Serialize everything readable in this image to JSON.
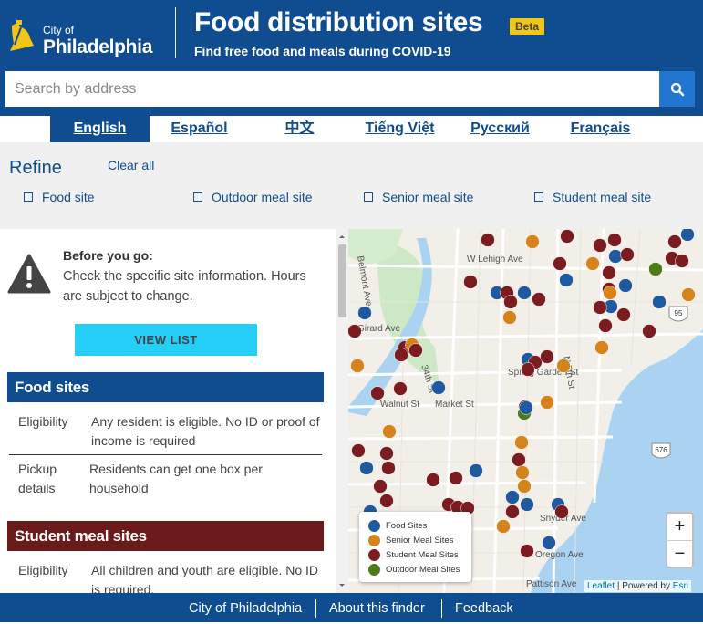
{
  "header": {
    "logo_small": "City of",
    "logo_big": "Philadelphia",
    "title": "Food distribution sites",
    "badge": "Beta",
    "subtitle": "Find free food and meals during COVID-19"
  },
  "search": {
    "placeholder": "Search by address",
    "button_icon": "search-icon"
  },
  "languages": [
    "English",
    "Español",
    "中文",
    "Tiếng Việt",
    "Русский",
    "Français"
  ],
  "active_language": "English",
  "refine": {
    "title": "Refine",
    "clear_all": "Clear all",
    "filters": [
      "Food site",
      "Outdoor meal site",
      "Senior meal site",
      "Student meal site"
    ]
  },
  "panel": {
    "notice_title": "Before you go:",
    "notice_text": "Check the specific site information. Hours are subject to change.",
    "view_list": "VIEW LIST",
    "sections": [
      {
        "title": "Food sites",
        "color": "#0f4d90",
        "rows": [
          {
            "label": "Eligibility",
            "value": "Any resident is eligible. No ID or proof of income is required"
          },
          {
            "label": "Pickup details",
            "value": "Residents can get one box per household"
          }
        ]
      },
      {
        "title": "Student meal sites",
        "color": "#6b1a1a",
        "rows": [
          {
            "label": "Eligibility",
            "value": "All children and youth are eligible. No ID is required."
          }
        ]
      }
    ]
  },
  "map": {
    "streets": [
      "W Lehigh Ave",
      "Belmont Ave",
      "Girard Ave",
      "34th St",
      "Spring Garden St",
      "N 5th St",
      "Walnut St",
      "Market St",
      "Snyder Ave",
      "Oregon Ave",
      "Pattison Ave"
    ],
    "shields": [
      "95",
      "676"
    ],
    "legend": [
      {
        "label": "Food Sites",
        "color": "#1f5aa0"
      },
      {
        "label": "Senior Meal Sites",
        "color": "#d5831a"
      },
      {
        "label": "Student Meal Sites",
        "color": "#7a1c20"
      },
      {
        "label": "Outdoor Meal Sites",
        "color": "#4f7a1a"
      }
    ],
    "zoom_in": "+",
    "zoom_out": "−",
    "attribution": {
      "leaflet": "Leaflet",
      "powered": "| Powered by",
      "esri": "Esri"
    }
  },
  "footer": {
    "links": [
      "City of Philadelphia",
      "About this finder",
      "Feedback"
    ]
  }
}
